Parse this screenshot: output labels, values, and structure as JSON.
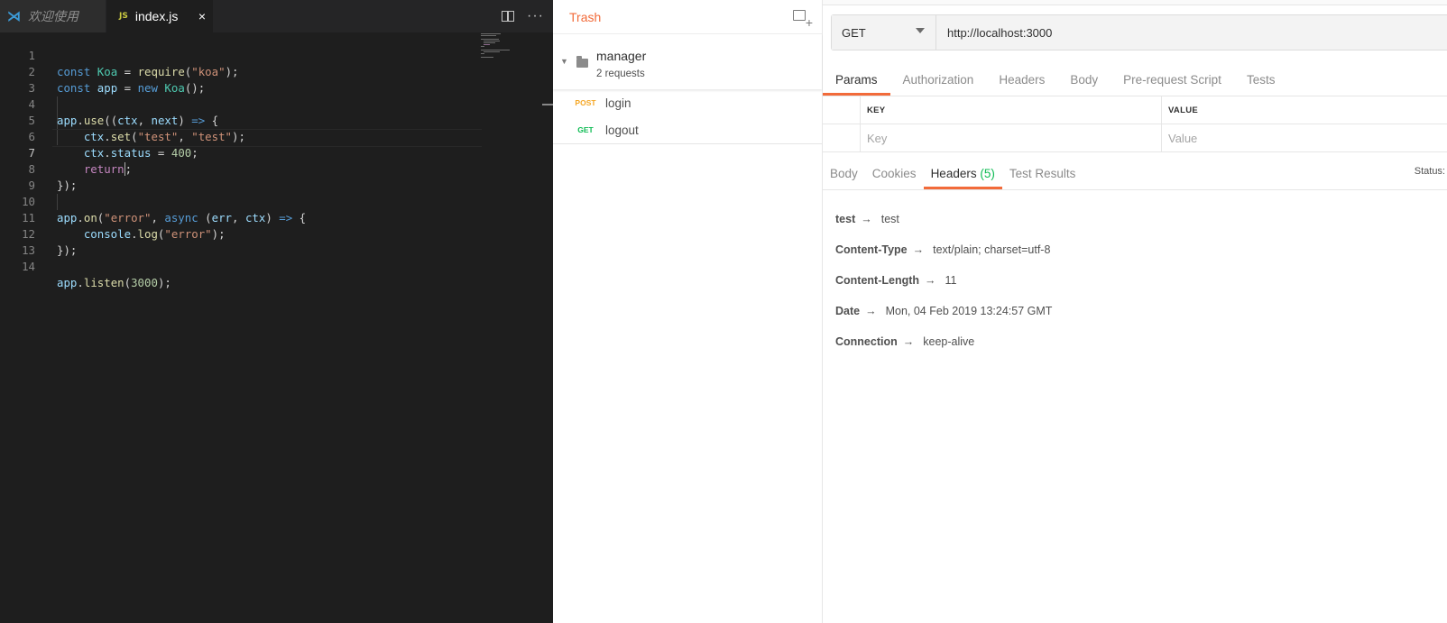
{
  "editor": {
    "tabs": [
      {
        "label": "欢迎使用",
        "icon": "vscode-icon"
      },
      {
        "label": "index.js",
        "icon": "js-file-icon",
        "close": "×"
      }
    ],
    "line_numbers": [
      "1",
      "2",
      "3",
      "4",
      "5",
      "6",
      "7",
      "8",
      "9",
      "10",
      "11",
      "12",
      "13",
      "14"
    ],
    "code": {
      "l1": [
        "const",
        "Koa",
        " = ",
        "require",
        "(",
        "\"koa\"",
        ");"
      ],
      "l2": [
        "const",
        "app",
        " = ",
        "new",
        "Koa",
        "();"
      ],
      "l4": [
        "app",
        ".",
        "use",
        "((",
        "ctx",
        ", ",
        "next",
        ") ",
        "=>",
        " {"
      ],
      "l5": [
        "ctx",
        ".",
        "set",
        "(",
        "\"test\"",
        ", ",
        "\"test\"",
        ");"
      ],
      "l6": [
        "ctx",
        ".",
        "status",
        " = ",
        "400",
        ";"
      ],
      "l7": [
        "return",
        ";"
      ],
      "l8": [
        "});"
      ],
      "l10": [
        "app",
        ".",
        "on",
        "(",
        "\"error\"",
        ", ",
        "async",
        " (",
        "err",
        ", ",
        "ctx",
        ") ",
        "=>",
        " {"
      ],
      "l11": [
        "console",
        ".",
        "log",
        "(",
        "\"error\"",
        ");"
      ],
      "l12": [
        "});"
      ],
      "l14": [
        "app",
        ".",
        "listen",
        "(",
        "3000",
        ");"
      ]
    }
  },
  "sidebar": {
    "header": "Trash",
    "folder": {
      "name": "manager",
      "subtitle": "2 requests"
    },
    "requests": [
      {
        "method": "POST",
        "name": "login"
      },
      {
        "method": "GET",
        "name": "logout"
      }
    ]
  },
  "request": {
    "method": "GET",
    "url": "http://localhost:3000",
    "tabs": [
      "Params",
      "Authorization",
      "Headers",
      "Body",
      "Pre-request Script",
      "Tests"
    ],
    "params": {
      "key_header": "KEY",
      "value_header": "VALUE",
      "key_placeholder": "Key",
      "value_placeholder": "Value"
    }
  },
  "response": {
    "tabs": [
      "Body",
      "Cookies",
      "Headers",
      "Test Results"
    ],
    "headers_count": "(5)",
    "status_label": "Status:",
    "arrow": "→",
    "headers": [
      {
        "key": "test",
        "value": "test"
      },
      {
        "key": "Content-Type",
        "value": "text/plain; charset=utf-8"
      },
      {
        "key": "Content-Length",
        "value": "11"
      },
      {
        "key": "Date",
        "value": "Mon, 04 Feb 2019 13:24:57 GMT"
      },
      {
        "key": "Connection",
        "value": "keep-alive"
      }
    ]
  },
  "colors": {
    "accent": "#f26b3a",
    "post": "#f5a623",
    "get": "#0cbb52"
  }
}
